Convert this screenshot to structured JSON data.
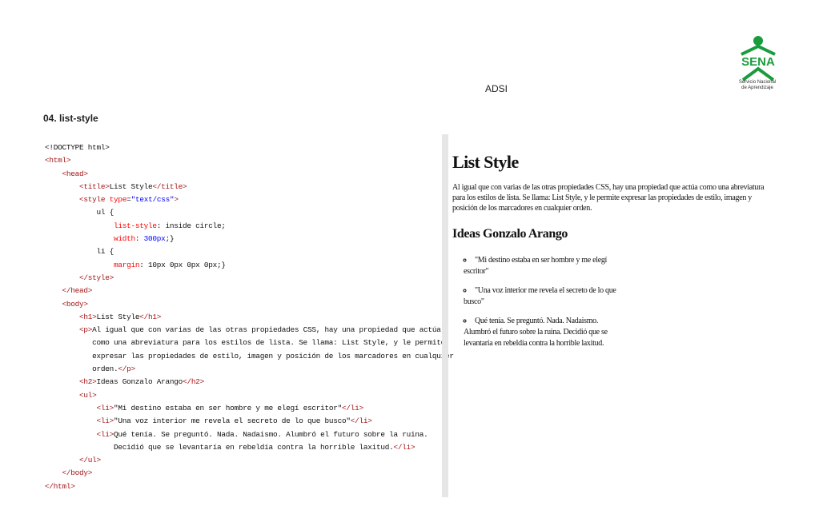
{
  "header": {
    "center_label": "ADSI",
    "logo": {
      "wordmark": "SENA",
      "caption_line1": "Servicio Nacional",
      "caption_line2": "de Aprendizaje",
      "color": "#1a9c3e"
    }
  },
  "section_title": "04. list-style",
  "code_lines": [
    [
      [
        "p",
        "<!DOCTYPE html>"
      ]
    ],
    [
      [
        "t",
        "<html>"
      ]
    ],
    [
      [
        "p",
        "    "
      ],
      [
        "t",
        "<head>"
      ]
    ],
    [
      [
        "p",
        "        "
      ],
      [
        "t",
        "<title>"
      ],
      [
        "p",
        "List Style"
      ],
      [
        "t",
        "</title>"
      ]
    ],
    [
      [
        "p",
        "        "
      ],
      [
        "t",
        "<style "
      ],
      [
        "a",
        "type"
      ],
      [
        "p",
        "="
      ],
      [
        "v",
        "\"text/css\""
      ],
      [
        "t",
        ">"
      ]
    ],
    [
      [
        "p",
        "            ul {"
      ]
    ],
    [
      [
        "p",
        "                "
      ],
      [
        "a",
        "list-style"
      ],
      [
        "p",
        ": inside circle;"
      ]
    ],
    [
      [
        "p",
        "                "
      ],
      [
        "a",
        "width"
      ],
      [
        "p",
        ": "
      ],
      [
        "v",
        "300px"
      ],
      [
        "p",
        ";}"
      ]
    ],
    [
      [
        "p",
        "            li {"
      ]
    ],
    [
      [
        "p",
        "                "
      ],
      [
        "a",
        "margin"
      ],
      [
        "p",
        ": 10px 0px 0px 0px;}"
      ]
    ],
    [
      [
        "p",
        "        "
      ],
      [
        "t",
        "</style>"
      ]
    ],
    [
      [
        "p",
        "    "
      ],
      [
        "t",
        "</head>"
      ]
    ],
    [
      [
        "p",
        "    "
      ],
      [
        "t",
        "<body>"
      ]
    ],
    [
      [
        "p",
        "        "
      ],
      [
        "t",
        "<h1>"
      ],
      [
        "p",
        "List Style"
      ],
      [
        "t",
        "</h1>"
      ]
    ],
    [
      [
        "p",
        "        "
      ],
      [
        "t",
        "<p>"
      ],
      [
        "p",
        "Al igual que con varias de las otras propiedades CSS, hay una propiedad que actúa"
      ]
    ],
    [
      [
        "p",
        "           como una abreviatura para los estilos de lista. Se llama: List Style, y le permite"
      ]
    ],
    [
      [
        "p",
        "           expresar las propiedades de estilo, imagen y posición de los marcadores en cualquier"
      ]
    ],
    [
      [
        "p",
        "           orden."
      ],
      [
        "t",
        "</p>"
      ]
    ],
    [
      [
        "p",
        "        "
      ],
      [
        "t",
        "<h2>"
      ],
      [
        "p",
        "Ideas Gonzalo Arango"
      ],
      [
        "t",
        "</h2>"
      ]
    ],
    [
      [
        "p",
        "        "
      ],
      [
        "t",
        "<ul>"
      ]
    ],
    [
      [
        "p",
        "            "
      ],
      [
        "t",
        "<li>"
      ],
      [
        "p",
        "\"Mi destino estaba en ser hombre y me elegí escritor\""
      ],
      [
        "t",
        "</li>"
      ]
    ],
    [
      [
        "p",
        "            "
      ],
      [
        "t",
        "<li>"
      ],
      [
        "p",
        "\"Una voz interior me revela el secreto de lo que busco\""
      ],
      [
        "t",
        "</li>"
      ]
    ],
    [
      [
        "p",
        "            "
      ],
      [
        "t",
        "<li>"
      ],
      [
        "p",
        "Qué tenía. Se preguntó. Nada. Nadaismo. Alumbró el futuro sobre la ruina."
      ]
    ],
    [
      [
        "p",
        "                Decidió que se levantaría en rebeldía contra la horrible laxitud."
      ],
      [
        "t",
        "</li>"
      ]
    ],
    [
      [
        "p",
        "        "
      ],
      [
        "t",
        "</ul>"
      ]
    ],
    [
      [
        "p",
        "    "
      ],
      [
        "t",
        "</body>"
      ]
    ],
    [
      [
        "t",
        "</html>"
      ]
    ]
  ],
  "preview": {
    "h1": "List Style",
    "paragraph": "Al igual que con varias de las otras propiedades CSS, hay una propiedad que actúa como una abreviatura para los estilos de lista. Se llama: List Style, y le permite expresar las propiedades de estilo, imagen y posición de los marcadores en cualquier orden.",
    "h2": "Ideas Gonzalo Arango",
    "items": [
      "\"Mi destino estaba en ser hombre y me elegí escritor\"",
      "\"Una voz interior me revela el secreto de lo que busco\"",
      "Qué tenía. Se preguntó. Nada. Nadaismo. Alumbró el futuro sobre la ruina. Decidió que se levantaría en rebeldía contra la horrible laxitud."
    ]
  }
}
